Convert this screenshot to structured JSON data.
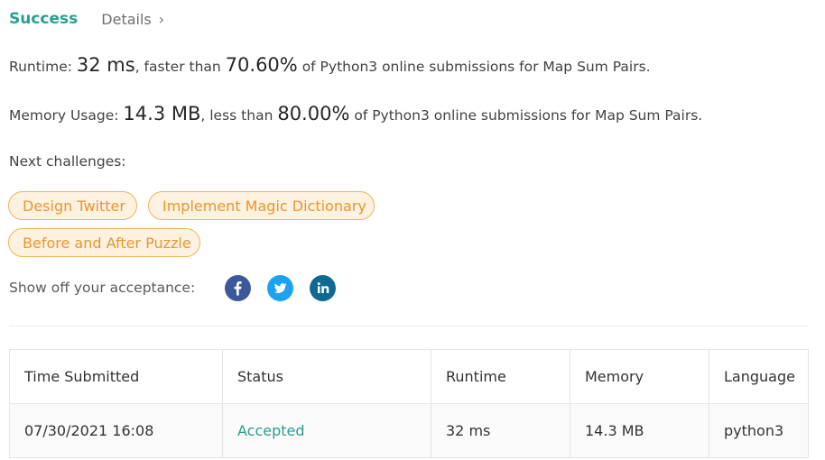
{
  "tabs": {
    "success": "Success",
    "details": "Details"
  },
  "runtime": {
    "label": "Runtime:",
    "value": "32 ms",
    "comparison": ", faster than",
    "percent": "70.60%",
    "suffix": "of Python3 online submissions for Map Sum Pairs."
  },
  "memory": {
    "label": "Memory Usage:",
    "value": "14.3 MB",
    "comparison": ", less than",
    "percent": "80.00%",
    "suffix": "of Python3 online submissions for Map Sum Pairs."
  },
  "next_challenges": {
    "label": "Next challenges:",
    "items": [
      "Design Twitter",
      "Implement Magic Dictionary",
      "Before and After Puzzle"
    ]
  },
  "share": {
    "label": "Show off your acceptance:",
    "icons": [
      "facebook-icon",
      "twitter-icon",
      "linkedin-icon"
    ]
  },
  "table": {
    "headers": [
      "Time Submitted",
      "Status",
      "Runtime",
      "Memory",
      "Language"
    ],
    "rows": [
      [
        "07/30/2021 16:08",
        "Accepted",
        "32 ms",
        "14.3 MB",
        "python3"
      ]
    ]
  },
  "colors": {
    "accent": "#2a9d8f",
    "chip_text": "#e9962c",
    "chip_border": "#f0b35a",
    "chip_bg": "#fdf2e0",
    "facebook": "#3b5998",
    "twitter": "#1da1f2",
    "linkedin": "#0e6a92"
  }
}
